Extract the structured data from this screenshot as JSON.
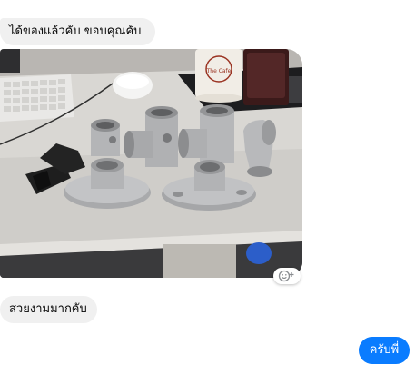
{
  "messages": [
    {
      "id": "msg1",
      "direction": "incoming",
      "text": "ได้ของแล้วคับ ขอบคุณคับ"
    },
    {
      "id": "msg2",
      "direction": "incoming",
      "type": "photo",
      "photo_mug_text": "The Cafe"
    },
    {
      "id": "msg3",
      "direction": "incoming",
      "text": "สวยงามมากคับ"
    },
    {
      "id": "msg4",
      "direction": "outgoing",
      "text": "ครับพี่"
    }
  ],
  "colors": {
    "incoming_bubble": "#f0f0f0",
    "outgoing_bubble": "#0a7cff"
  },
  "icons": {
    "reaction": "smiley-plus-icon"
  }
}
